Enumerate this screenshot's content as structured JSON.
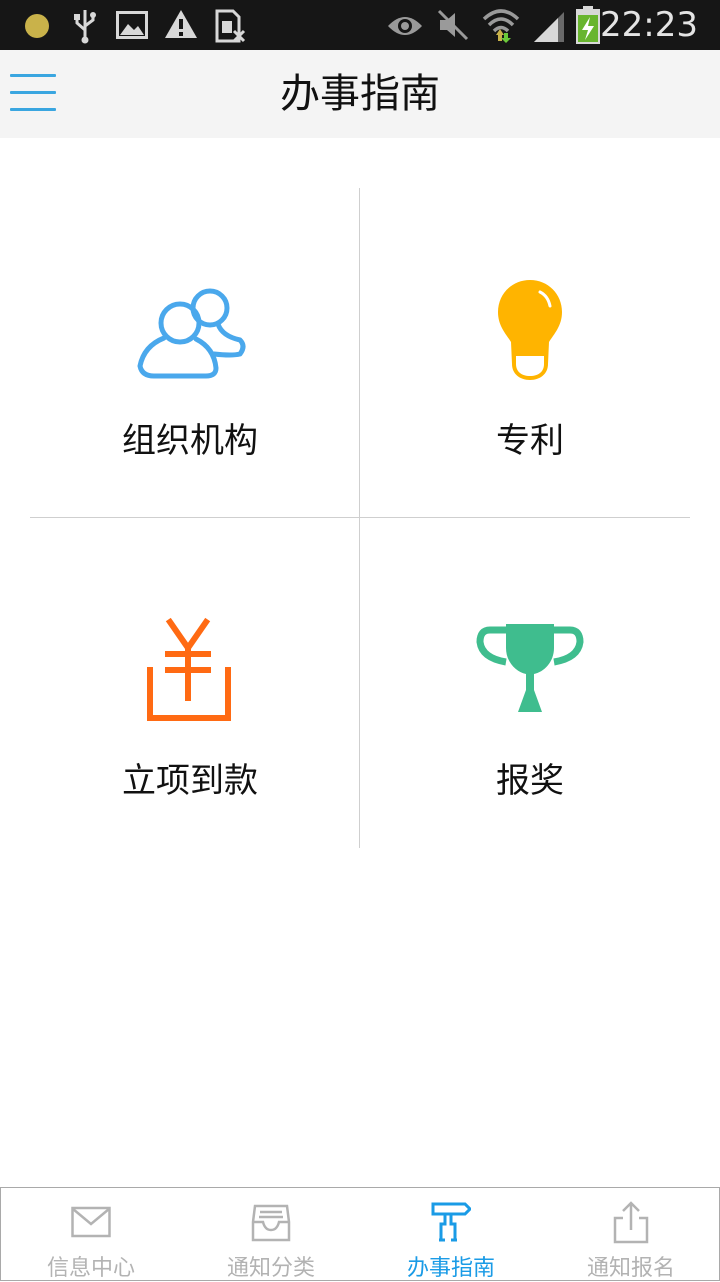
{
  "status_bar": {
    "time": "22:23",
    "icons": [
      "notification-dot-icon",
      "usb-icon",
      "image-icon",
      "warning-icon",
      "sim-icon",
      "eye-icon",
      "mute-icon",
      "wifi-icon",
      "signal-icon",
      "battery-charging-icon"
    ]
  },
  "header": {
    "title": "办事指南",
    "menu_icon": "hamburger-menu-icon"
  },
  "grid": {
    "items": [
      {
        "label": "组织机构",
        "icon": "people-icon",
        "color": "#4aa8ec"
      },
      {
        "label": "专利",
        "icon": "lightbulb-icon",
        "color": "#ffb400"
      },
      {
        "label": "立项到款",
        "icon": "yuan-box-icon",
        "color": "#ff6a13"
      },
      {
        "label": "报奖",
        "icon": "trophy-icon",
        "color": "#3fbd8e"
      }
    ]
  },
  "tab_bar": {
    "tabs": [
      {
        "label": "信息中心",
        "icon": "mail-icon",
        "active": false
      },
      {
        "label": "通知分类",
        "icon": "inbox-tray-icon",
        "active": false
      },
      {
        "label": "办事指南",
        "icon": "signpost-icon",
        "active": true
      },
      {
        "label": "通知报名",
        "icon": "share-upload-icon",
        "active": false
      }
    ],
    "active_color": "#1a9be6",
    "inactive_color": "#b3b3b3"
  }
}
